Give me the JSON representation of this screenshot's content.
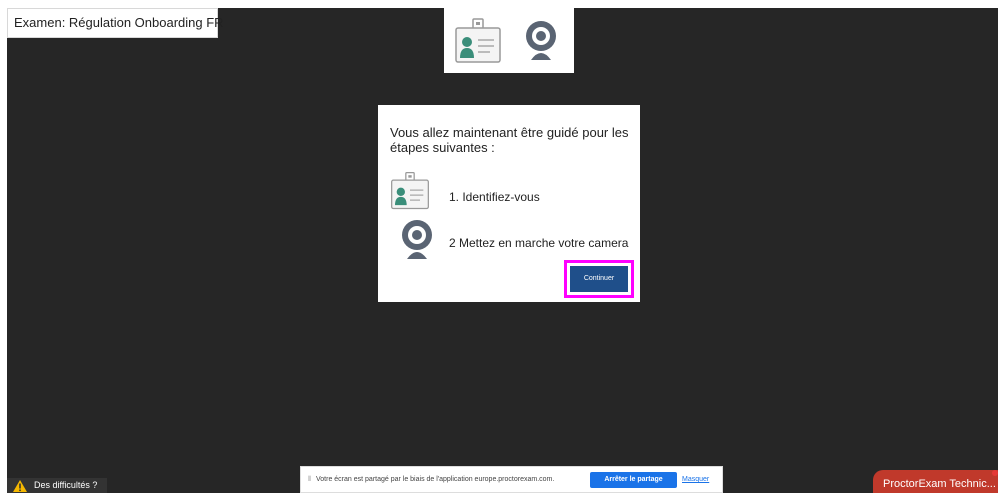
{
  "exam": {
    "title": "Examen: Régulation Onboarding FR"
  },
  "top_icons": [
    "id-card-icon",
    "webcam-icon"
  ],
  "dialog": {
    "intro": "Vous allez maintenant être guidé pour les étapes suivantes :",
    "steps": [
      {
        "icon": "id-card-icon",
        "label": "1. Identifiez-vous"
      },
      {
        "icon": "webcam-icon",
        "label": "2 Mettez en marche votre camera"
      }
    ],
    "continue_label": "Continuer"
  },
  "help": {
    "label": "Des difficultés ?",
    "icon": "warning-icon"
  },
  "share_bar": {
    "grip": "⦀",
    "message": "Votre écran est partagé par le biais de l'application europe.proctorexam.com.",
    "stop_label": "Arrêter le partage",
    "hide_label": "Masquer"
  },
  "support": {
    "label": "ProctorExam Technic..."
  },
  "colors": {
    "background": "#262626",
    "button": "#1f4f8a",
    "highlight": "#ff00ff",
    "support": "#c0392b",
    "share_button": "#1a73e8"
  }
}
